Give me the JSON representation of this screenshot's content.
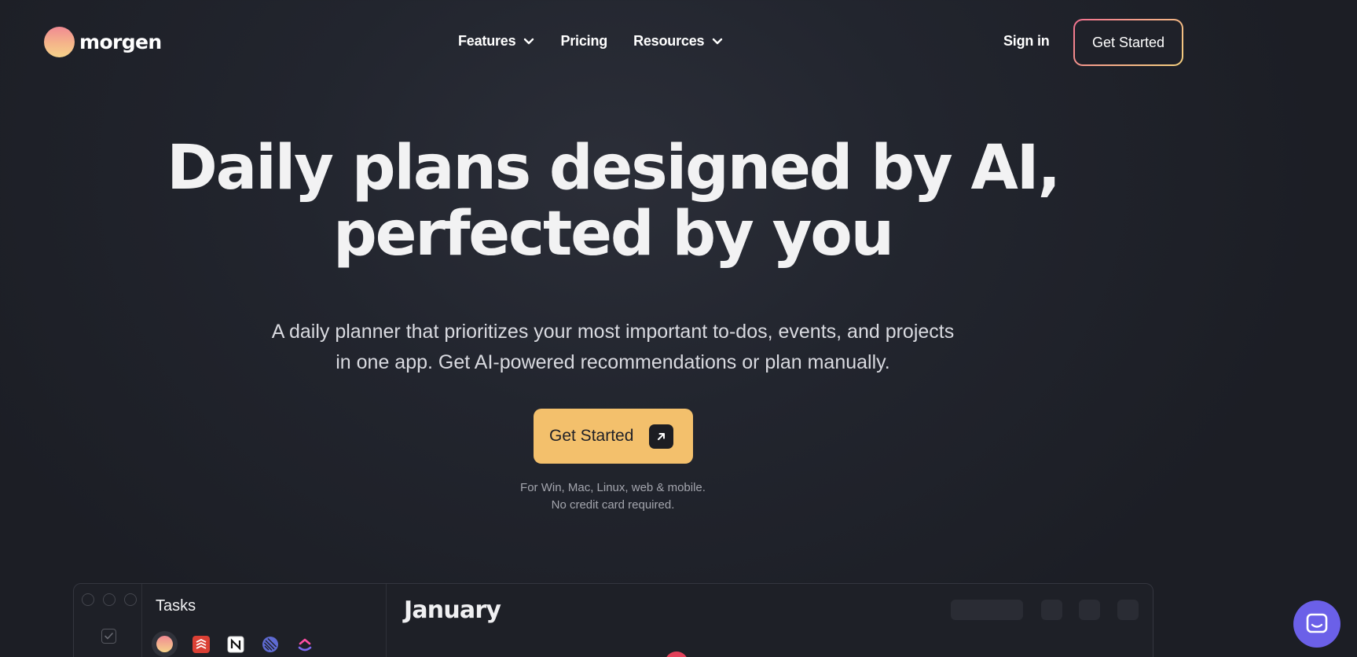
{
  "header": {
    "logo_text": "morgen",
    "nav": [
      {
        "label": "Features",
        "has_dropdown": true
      },
      {
        "label": "Pricing",
        "has_dropdown": false
      },
      {
        "label": "Resources",
        "has_dropdown": true
      }
    ],
    "sign_in_label": "Sign in",
    "cta_label": "Get Started"
  },
  "hero": {
    "title_line1": "Daily plans designed by AI,",
    "title_line2": "perfected by you",
    "subtitle_line1": "A daily planner that prioritizes your most important to-dos, events, and projects",
    "subtitle_line2": "in one app. Get AI-powered recommendations or plan manually.",
    "cta_label": "Get Started",
    "note_line1": "For Win, Mac, Linux, web & mobile.",
    "note_line2": "No credit card required."
  },
  "preview": {
    "tasks_title": "Tasks",
    "calendar_month": "January",
    "integration_icons": [
      "morgen-icon",
      "todoist-icon",
      "notion-icon",
      "linear-icon",
      "clickup-icon"
    ]
  },
  "colors": {
    "background": "#1c1e25",
    "cta_yellow": "#f3c06c",
    "chat_purple": "#6b60e8",
    "accent_gradient_start": "#f1708f",
    "accent_gradient_end": "#f4d07e"
  }
}
